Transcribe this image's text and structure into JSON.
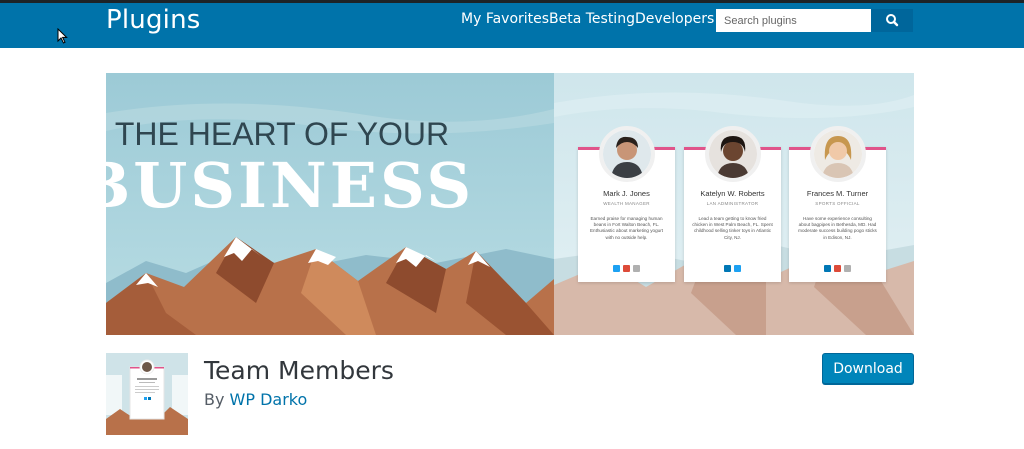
{
  "header": {
    "brand": "Plugins",
    "nav": [
      "My Favorites",
      "Beta Testing",
      "Developers"
    ],
    "search_placeholder": "Search plugins",
    "search_icon": "search-icon"
  },
  "banner": {
    "headline_top": "THE HEART OF YOUR",
    "headline_bottom": "BUSINESS",
    "cards": [
      {
        "name": "Mark J. Jones",
        "role": "WEALTH MANAGER",
        "bio": "Earned praise for managing human beans in Fort Walton Beach, FL. Enthusiastic about marketing yogurt with no outside help.",
        "socials": [
          "twitter-icon",
          "google-plus-icon",
          "link-icon"
        ]
      },
      {
        "name": "Katelyn  W. Roberts",
        "role": "LAN ADMINISTRATOR",
        "bio": "Lead a team getting to know fried chicken in West Palm Beach, FL. Spent childhood selling tinker toys in Atlantic City, NJ.",
        "socials": [
          "linkedin-icon",
          "twitter-icon"
        ]
      },
      {
        "name": "Frances M.  Turner",
        "role": "SPORTS OFFICIAL",
        "bio": "Have some experience consulting about bagpipes in Bethesda, MD. Had moderate success building pogo sticks in Edison, NJ.",
        "socials": [
          "linkedin-icon",
          "google-plus-icon",
          "link-icon"
        ]
      }
    ]
  },
  "plugin": {
    "title": "Team Members",
    "by_prefix": "By",
    "author": "WP Darko",
    "download_label": "Download"
  },
  "colors": {
    "header_bg": "#0073aa",
    "accent": "#0085ba",
    "card_border": "#e0548a"
  }
}
